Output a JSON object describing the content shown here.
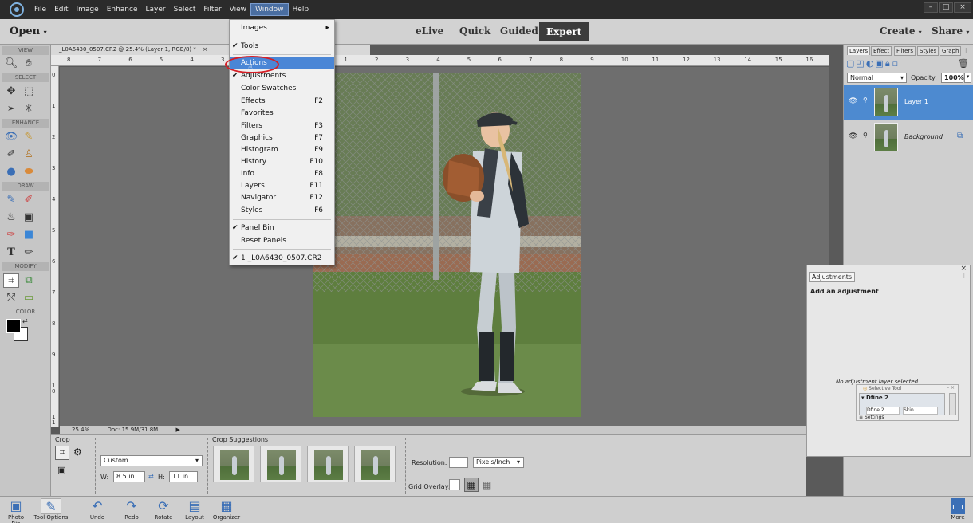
{
  "menubar": {
    "items": [
      "File",
      "Edit",
      "Image",
      "Enhance",
      "Layer",
      "Select",
      "Filter",
      "View",
      "Window",
      "Help"
    ],
    "active": "Window"
  },
  "window_buttons": {
    "minimize": "–",
    "maximize": "□",
    "close": "×"
  },
  "modebar": {
    "open": "Open",
    "modes": [
      "eLive",
      "Quick",
      "Guided",
      "Expert"
    ],
    "active_mode": "Expert",
    "create": "Create",
    "share": "Share"
  },
  "toolbox": {
    "sections": [
      "VIEW",
      "SELECT",
      "ENHANCE",
      "DRAW",
      "MODIFY",
      "COLOR"
    ]
  },
  "document": {
    "tab_title": "_L0A6430_0507.CR2 @ 25.4% (Layer 1, RGB/8) *",
    "tab_close": "×",
    "ruler_top": [
      "8",
      "7",
      "6",
      "5",
      "4",
      "3",
      "2",
      "1",
      "0",
      "1",
      "2",
      "3",
      "4",
      "5",
      "6",
      "7",
      "8",
      "9",
      "10",
      "11",
      "12",
      "13",
      "14",
      "15",
      "16"
    ],
    "ruler_left": [
      "0",
      "1",
      "2",
      "3",
      "4",
      "5",
      "6",
      "7",
      "8",
      "9",
      "1\n0",
      "1\n1"
    ],
    "zoom": "25.4%",
    "doc_size": "Doc: 15.9M/31.8M"
  },
  "tool_options": {
    "tool_name": "Crop",
    "crop_suggestions_label": "Crop Suggestions",
    "preset": "Custom",
    "width_label": "W:",
    "width_value": "8.5 in",
    "height_label": "H:",
    "height_value": "11 in",
    "resolution_label": "Resolution:",
    "resolution_value": "",
    "resolution_unit": "Pixels/Inch",
    "grid_overlay_label": "Grid Overlay:"
  },
  "layers_panel": {
    "tabs": [
      "Layers",
      "Effect",
      "Filters",
      "Styles",
      "Graph"
    ],
    "blend_mode": "Normal",
    "opacity_label": "Opacity:",
    "opacity_value": "100%",
    "layers": [
      {
        "name": "Layer 1",
        "selected": true
      },
      {
        "name": "Background",
        "selected": false
      }
    ]
  },
  "adjustments_panel": {
    "tab": "Adjustments",
    "title": "Add an adjustment",
    "empty_text": "No adjustment layer selected",
    "selective_tool": {
      "title": "Selective Tool",
      "item": "Dfine 2",
      "col1": "Dfine 2",
      "col2": "Skin",
      "settings": "Settings"
    }
  },
  "window_menu": {
    "items": [
      {
        "label": "Images",
        "check": false,
        "key": "",
        "submenu": true,
        "highlight": false
      },
      {
        "label": "Tools",
        "check": true,
        "key": "",
        "submenu": false,
        "highlight": false
      },
      {
        "label": "Actions",
        "check": false,
        "key": "",
        "submenu": false,
        "highlight": true
      },
      {
        "label": "Adjustments",
        "check": true,
        "key": "",
        "submenu": false,
        "highlight": false
      },
      {
        "label": "Color Swatches",
        "check": false,
        "key": "",
        "submenu": false,
        "highlight": false
      },
      {
        "label": "Effects",
        "check": false,
        "key": "F2",
        "submenu": false,
        "highlight": false
      },
      {
        "label": "Favorites",
        "check": false,
        "key": "",
        "submenu": false,
        "highlight": false
      },
      {
        "label": "Filters",
        "check": false,
        "key": "F3",
        "submenu": false,
        "highlight": false
      },
      {
        "label": "Graphics",
        "check": false,
        "key": "F7",
        "submenu": false,
        "highlight": false
      },
      {
        "label": "Histogram",
        "check": false,
        "key": "F9",
        "submenu": false,
        "highlight": false
      },
      {
        "label": "History",
        "check": false,
        "key": "F10",
        "submenu": false,
        "highlight": false
      },
      {
        "label": "Info",
        "check": false,
        "key": "F8",
        "submenu": false,
        "highlight": false
      },
      {
        "label": "Layers",
        "check": false,
        "key": "F11",
        "submenu": false,
        "highlight": false
      },
      {
        "label": "Navigator",
        "check": false,
        "key": "F12",
        "submenu": false,
        "highlight": false
      },
      {
        "label": "Styles",
        "check": false,
        "key": "F6",
        "submenu": false,
        "highlight": false
      },
      {
        "label": "Panel Bin",
        "check": true,
        "key": "",
        "submenu": false,
        "highlight": false
      },
      {
        "label": "Reset Panels",
        "check": false,
        "key": "",
        "submenu": false,
        "highlight": false
      },
      {
        "label": "1 _L0A6430_0507.CR2",
        "check": true,
        "key": "",
        "submenu": false,
        "highlight": false
      }
    ]
  },
  "bottombar": {
    "left": [
      "Photo Bin",
      "Tool Options",
      "Undo",
      "Redo",
      "Rotate",
      "Layout",
      "Organizer"
    ],
    "right": "More"
  },
  "colors": {
    "menu_highlight": "#4a86d6",
    "layer_selected": "#4d8ad0",
    "annotation_circle": "#d61f26",
    "icon_blue": "#3b6fb6"
  }
}
